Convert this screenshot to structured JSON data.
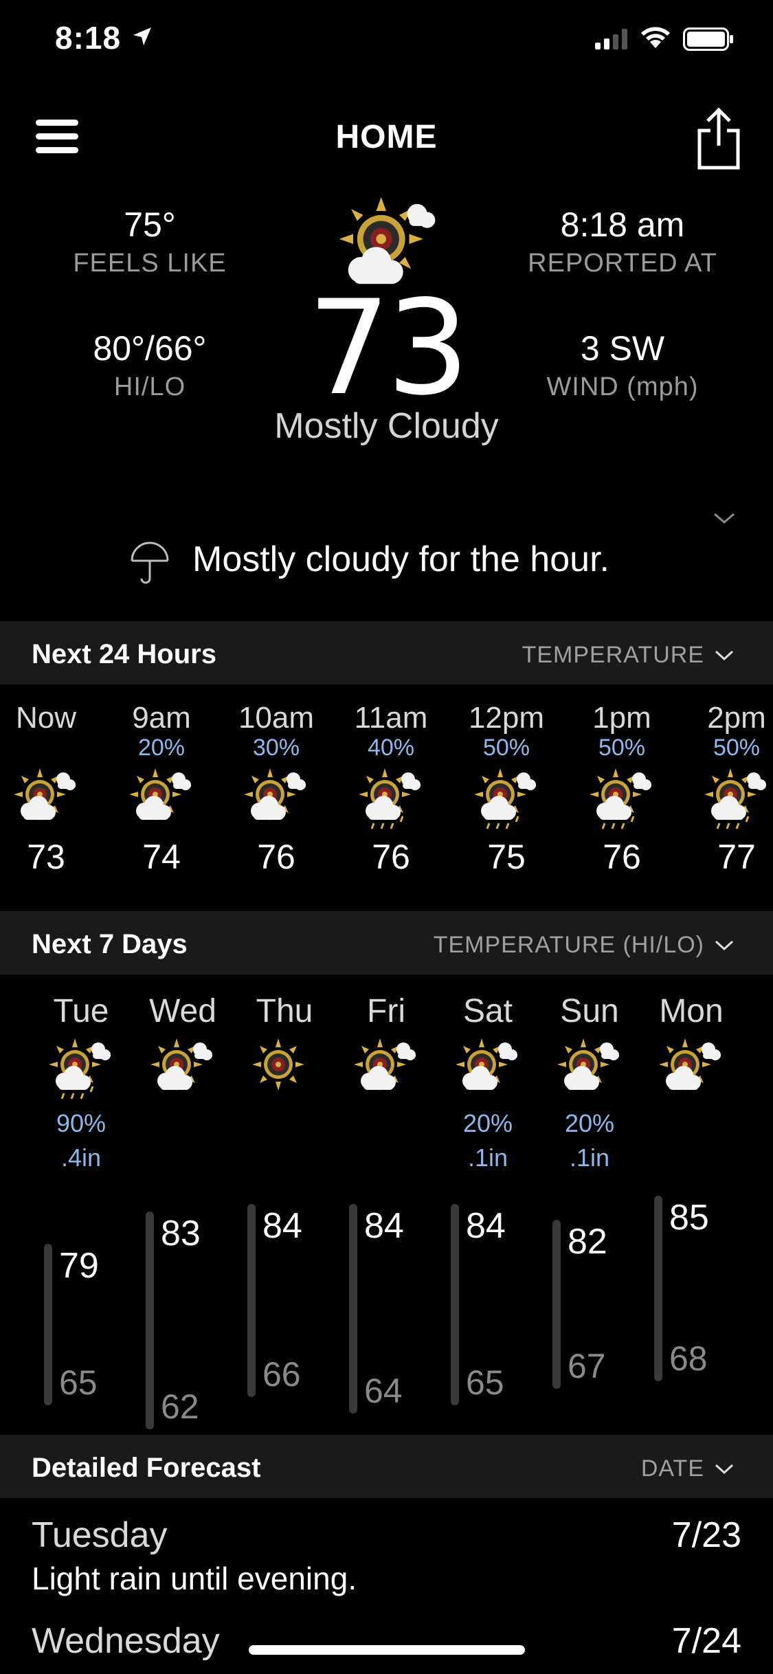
{
  "status_bar": {
    "time": "8:18"
  },
  "nav": {
    "title": "HOME"
  },
  "current": {
    "feels_like_value": "75°",
    "feels_like_label": "FEELS LIKE",
    "hilo_value": "80°/66°",
    "hilo_label": "HI/LO",
    "reported_value": "8:18 am",
    "reported_label": "REPORTED AT",
    "wind_value": "3 SW",
    "wind_label": "WIND (mph)",
    "temperature": "73",
    "condition": "Mostly Cloudy",
    "icon": "mostly-cloudy-icon"
  },
  "nowcast": {
    "icon": "umbrella-icon",
    "text": "Mostly cloudy for the hour."
  },
  "hourly": {
    "title": "Next 24 Hours",
    "selector": "TEMPERATURE",
    "items": [
      {
        "time": "Now",
        "precip": "",
        "temp": "73",
        "icon": "mostly-cloudy-icon"
      },
      {
        "time": "9am",
        "precip": "20%",
        "temp": "74",
        "icon": "mostly-cloudy-icon"
      },
      {
        "time": "10am",
        "precip": "30%",
        "temp": "76",
        "icon": "mostly-cloudy-icon"
      },
      {
        "time": "11am",
        "precip": "40%",
        "temp": "76",
        "icon": "rain-icon"
      },
      {
        "time": "12pm",
        "precip": "50%",
        "temp": "75",
        "icon": "rain-icon"
      },
      {
        "time": "1pm",
        "precip": "50%",
        "temp": "76",
        "icon": "rain-icon"
      },
      {
        "time": "2pm",
        "precip": "50%",
        "temp": "77",
        "icon": "rain-icon"
      }
    ]
  },
  "daily": {
    "title": "Next 7 Days",
    "selector": "TEMPERATURE (HI/LO)",
    "items": [
      {
        "day": "Tue",
        "precip": "90%",
        "amount": ".4in",
        "hi": "79",
        "lo": "65",
        "icon": "rain-icon"
      },
      {
        "day": "Wed",
        "precip": "",
        "amount": "",
        "hi": "83",
        "lo": "62",
        "icon": "mostly-cloudy-icon"
      },
      {
        "day": "Thu",
        "precip": "",
        "amount": "",
        "hi": "84",
        "lo": "66",
        "icon": "sunny-icon"
      },
      {
        "day": "Fri",
        "precip": "",
        "amount": "",
        "hi": "84",
        "lo": "64",
        "icon": "mostly-cloudy-icon"
      },
      {
        "day": "Sat",
        "precip": "20%",
        "amount": ".1in",
        "hi": "84",
        "lo": "65",
        "icon": "mostly-cloudy-icon"
      },
      {
        "day": "Sun",
        "precip": "20%",
        "amount": ".1in",
        "hi": "82",
        "lo": "67",
        "icon": "mostly-cloudy-icon"
      },
      {
        "day": "Mon",
        "precip": "",
        "amount": "",
        "hi": "85",
        "lo": "68",
        "icon": "mostly-cloudy-icon"
      }
    ]
  },
  "detailed": {
    "title": "Detailed Forecast",
    "selector": "DATE",
    "items": [
      {
        "day": "Tuesday",
        "date": "7/23",
        "summary": "Light rain until evening."
      },
      {
        "day": "Wednesday",
        "date": "7/24",
        "summary": ""
      }
    ]
  },
  "colors": {
    "background": "#000000",
    "section_header": "#1a1a1a",
    "precip_blue": "#8fb7e8",
    "label_gray": "#9b9b9b"
  }
}
